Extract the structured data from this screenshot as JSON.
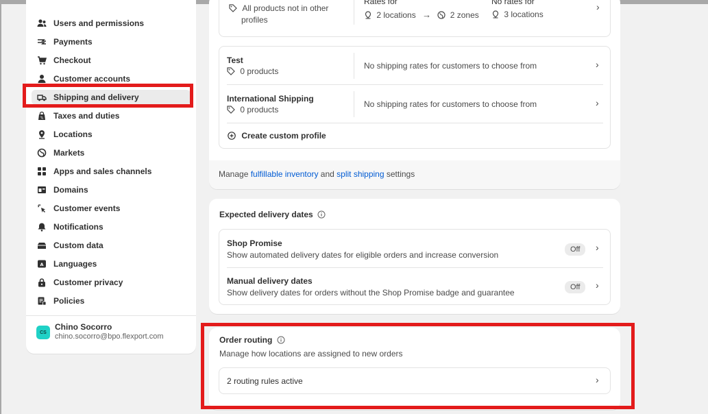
{
  "sidebar": {
    "items": [
      {
        "label": "Users and permissions",
        "icon": "users-icon"
      },
      {
        "label": "Payments",
        "icon": "payments-icon"
      },
      {
        "label": "Checkout",
        "icon": "cart-icon"
      },
      {
        "label": "Customer accounts",
        "icon": "person-icon"
      },
      {
        "label": "Shipping and delivery",
        "icon": "truck-icon"
      },
      {
        "label": "Taxes and duties",
        "icon": "tax-icon"
      },
      {
        "label": "Locations",
        "icon": "location-icon"
      },
      {
        "label": "Markets",
        "icon": "globe-icon"
      },
      {
        "label": "Apps and sales channels",
        "icon": "apps-icon"
      },
      {
        "label": "Domains",
        "icon": "domain-icon"
      },
      {
        "label": "Customer events",
        "icon": "cursor-icon"
      },
      {
        "label": "Notifications",
        "icon": "bell-icon"
      },
      {
        "label": "Custom data",
        "icon": "database-icon"
      },
      {
        "label": "Languages",
        "icon": "translate-icon"
      },
      {
        "label": "Customer privacy",
        "icon": "lock-icon"
      },
      {
        "label": "Policies",
        "icon": "policies-icon"
      }
    ],
    "user": {
      "initials": "CS",
      "name": "Chino Socorro",
      "email": "chino.socorro@bpo.flexport.com"
    }
  },
  "shipping": {
    "general": {
      "products": "All products not in other",
      "products_cont": "profiles",
      "rates_for": "Rates for",
      "locations": "2 locations",
      "arrow": "→",
      "zones": "2 zones",
      "no_rates_for": "No rates for",
      "no_rate_locations": "3 locations"
    },
    "profiles": [
      {
        "name": "Test",
        "products": "0 products",
        "status": "No shipping rates for customers to choose from"
      },
      {
        "name": "International Shipping",
        "products": "0 products",
        "status": "No shipping rates for customers to choose from"
      }
    ],
    "create_profile": "Create custom profile",
    "manage_prefix": "Manage",
    "fulfillable_link": "fulfillable inventory",
    "and_text": "and",
    "split_link": "split shipping",
    "settings_suffix": "settings"
  },
  "delivery_dates": {
    "title": "Expected delivery dates",
    "items": [
      {
        "title": "Shop Promise",
        "description": "Show automated delivery dates for eligible orders and increase conversion",
        "status": "Off"
      },
      {
        "title": "Manual delivery dates",
        "description": "Show delivery dates for orders without the Shop Promise badge and guarantee",
        "status": "Off"
      }
    ]
  },
  "order_routing": {
    "title": "Order routing",
    "description": "Manage how locations are assigned to new orders",
    "rules": "2 routing rules active"
  },
  "colors": {
    "accent": "#005bd3",
    "highlight": "#e31b1b",
    "avatar": "#1fd1c6"
  }
}
